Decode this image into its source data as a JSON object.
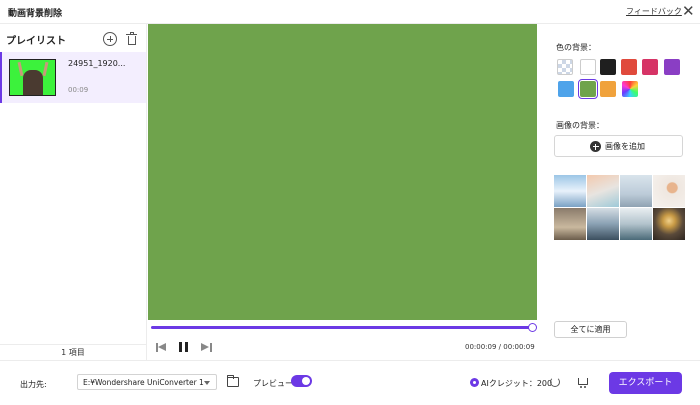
{
  "window": {
    "title": "動画背景削除",
    "feedback": "フィードバック",
    "close": "✕"
  },
  "playlist": {
    "title": "プレイリスト",
    "items": [
      {
        "name": "24951_1920...",
        "duration": "00:09"
      }
    ],
    "count": "1 項目"
  },
  "player": {
    "time": "00:00:09 / 00:00:09",
    "progress": 1.0,
    "preview_color": "#6fa34c"
  },
  "colors": {
    "label": "色の背景：",
    "swatches": [
      {
        "name": "transparent",
        "color": "transparent"
      },
      {
        "name": "white",
        "color": "#ffffff"
      },
      {
        "name": "black",
        "color": "#1f1f1f"
      },
      {
        "name": "red",
        "color": "#e04a3c"
      },
      {
        "name": "crimson",
        "color": "#d63466"
      },
      {
        "name": "purple",
        "color": "#8a3ec4"
      },
      {
        "name": "blue",
        "color": "#4ea3ea"
      },
      {
        "name": "green",
        "color": "#6fa34c",
        "selected": true
      },
      {
        "name": "orange",
        "color": "#f0a23c"
      },
      {
        "name": "rainbow",
        "color": "gradient"
      }
    ]
  },
  "images": {
    "label": "画像の背景：",
    "add_label": "画像を追加",
    "thumbnails": [
      "snow-mountain",
      "beach-sunset",
      "snowy-town",
      "minimal-interior",
      "cafe",
      "office-window",
      "city-balcony",
      "warm-lamp"
    ]
  },
  "apply_all": "全てに適用",
  "bottom": {
    "output_label": "出力先:",
    "output_path": "E:¥Wondershare UniConverter 1",
    "preview_label": "プレビュー",
    "ai_credit": "AIクレジット：200",
    "export": "エクスポート"
  },
  "accent": "#6c39e5"
}
